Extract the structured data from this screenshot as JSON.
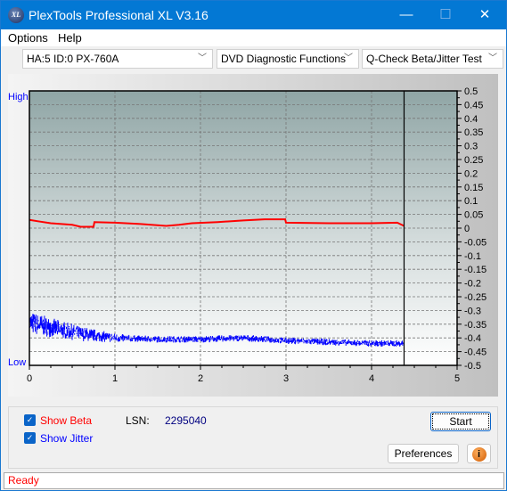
{
  "window": {
    "title": "PlexTools Professional XL V3.16",
    "logo_text": "XL",
    "minimize": "—",
    "maximize": "☐",
    "close": "✕",
    "title_bar_color": "#0378d4"
  },
  "menu": [
    {
      "label": "Options"
    },
    {
      "label": "Help"
    }
  ],
  "toolbar": {
    "drive": "HA:5 ID:0  PX-760A",
    "function": "DVD Diagnostic Functions",
    "test": "Q-Check Beta/Jitter Test"
  },
  "chart_data": {
    "type": "line",
    "xlim": [
      0,
      5
    ],
    "ylim": [
      -0.5,
      0.5
    ],
    "x_ticks": [
      "0",
      "1",
      "2",
      "3",
      "4",
      "5"
    ],
    "y_ticks": [
      "0.5",
      "0.45",
      "0.4",
      "0.35",
      "0.3",
      "0.25",
      "0.2",
      "0.15",
      "0.1",
      "0.05",
      "0",
      "-0.05",
      "-0.1",
      "-0.15",
      "-0.2",
      "-0.25",
      "-0.3",
      "-0.35",
      "-0.4",
      "-0.45",
      "-0.5"
    ],
    "left_labels": {
      "high": "High",
      "low": "Low"
    },
    "grid": true,
    "marker_x": 4.38,
    "series": [
      {
        "key": "beta",
        "color": "#ff0000",
        "x": [
          0,
          0.1,
          0.25,
          0.5,
          0.6,
          0.75,
          0.76,
          1.0,
          1.3,
          1.6,
          1.75,
          1.9,
          2.2,
          2.5,
          2.75,
          2.99,
          3.0,
          3.5,
          4.0,
          4.3,
          4.38
        ],
        "y": [
          0.03,
          0.025,
          0.018,
          0.012,
          0.005,
          0.005,
          0.022,
          0.02,
          0.015,
          0.008,
          0.012,
          0.018,
          0.022,
          0.028,
          0.032,
          0.032,
          0.02,
          0.018,
          0.018,
          0.02,
          0.008
        ]
      },
      {
        "key": "jitter",
        "color": "#0000ff",
        "x": [
          0,
          0.3,
          0.6,
          1.0,
          1.5,
          2.0,
          2.5,
          3.0,
          3.5,
          4.0,
          4.38
        ],
        "y": [
          -0.345,
          -0.365,
          -0.385,
          -0.4,
          -0.405,
          -0.405,
          -0.4,
          -0.41,
          -0.415,
          -0.42,
          -0.42
        ]
      }
    ]
  },
  "controls": {
    "show_beta": "Show Beta",
    "show_jitter": "Show Jitter",
    "beta_color": "#ff0000",
    "jitter_color": "#0000ff",
    "lsn_label": "LSN:",
    "lsn_value": "2295040",
    "start": "Start",
    "preferences": "Preferences",
    "info_icon": "i"
  },
  "status": "Ready"
}
